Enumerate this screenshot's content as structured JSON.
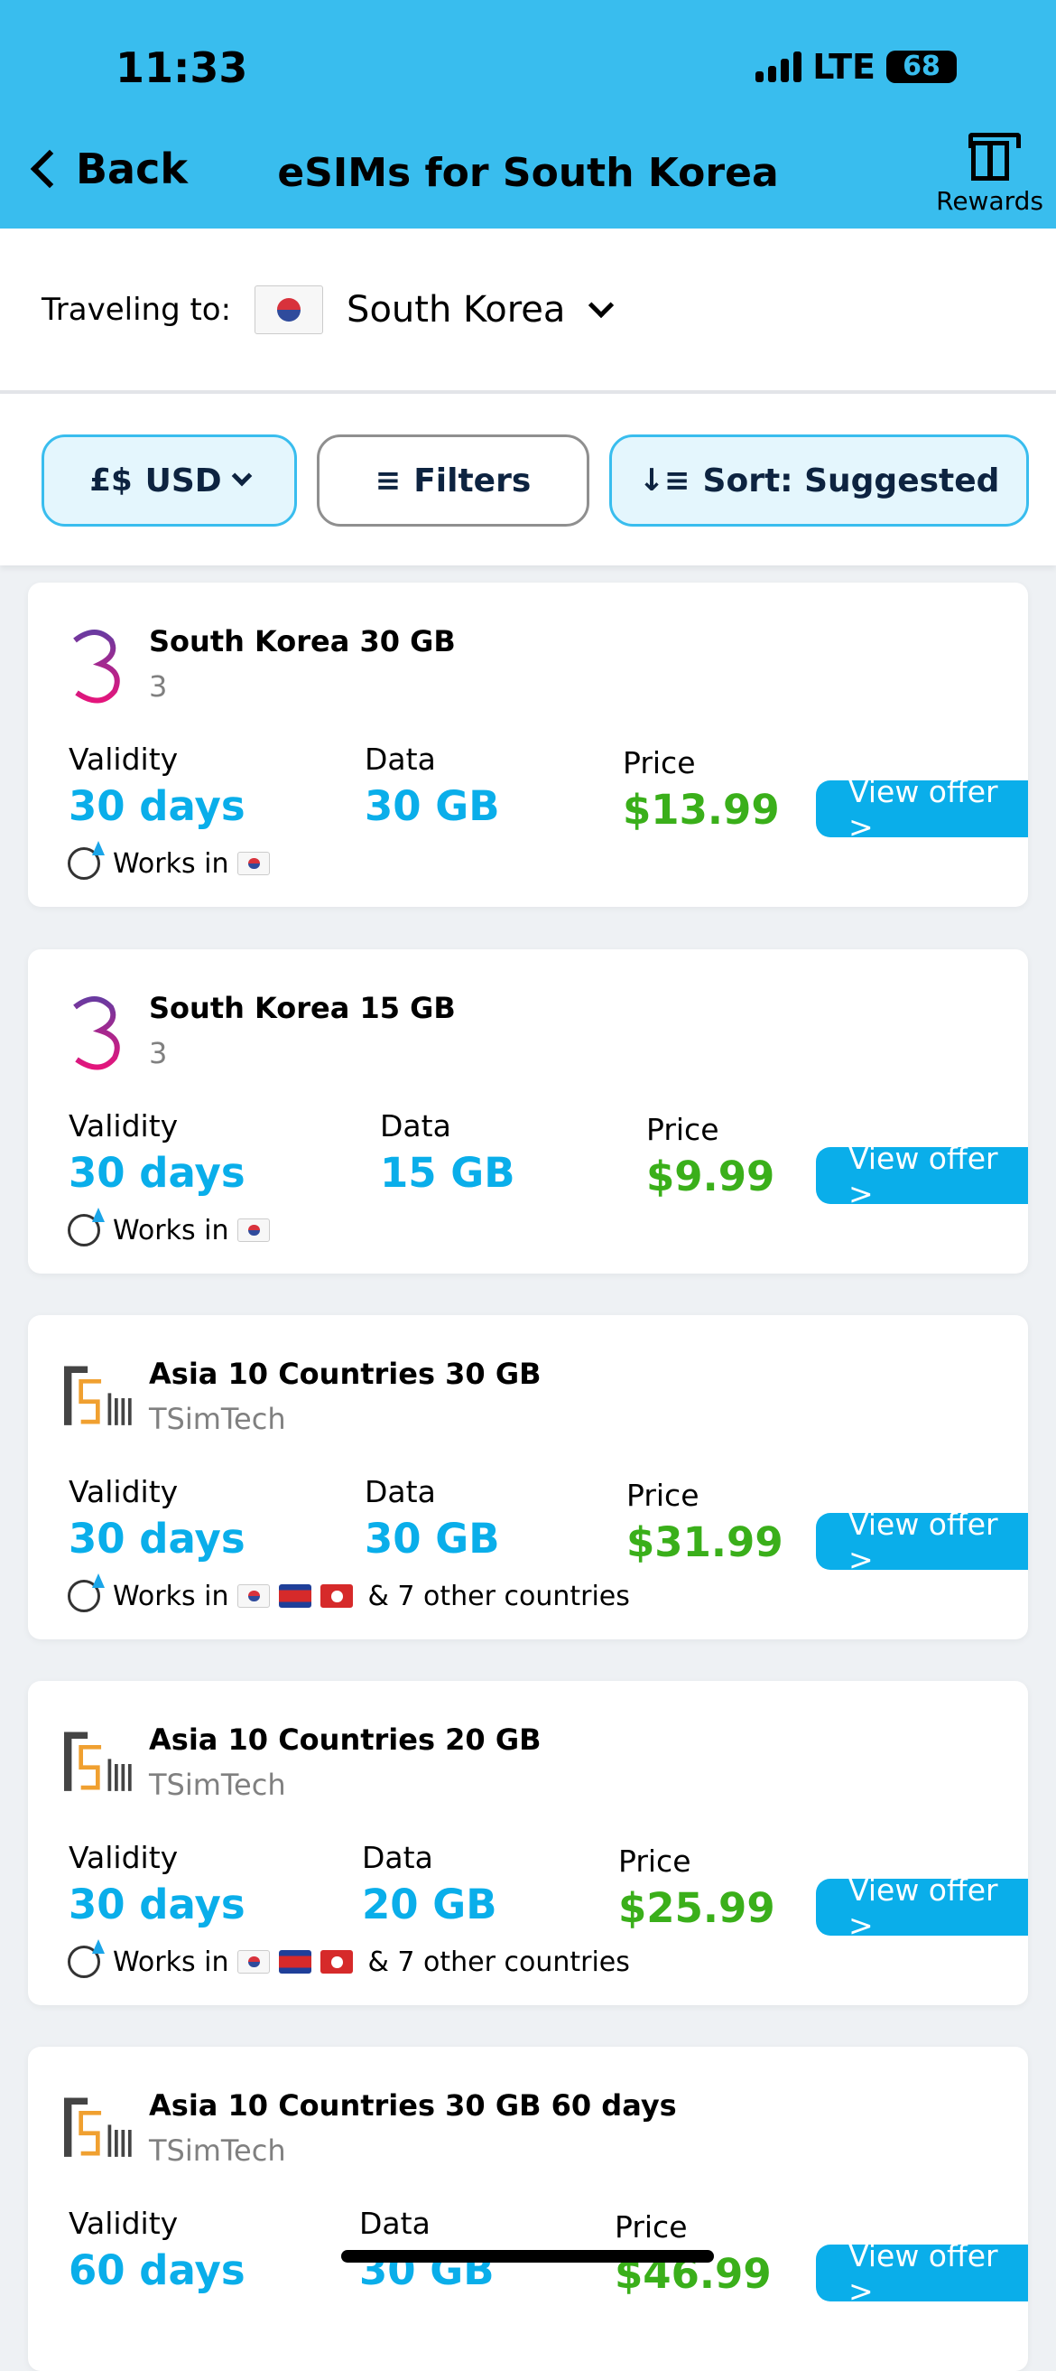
{
  "status_bar": {
    "time": "11:33",
    "network": "LTE",
    "battery": "68"
  },
  "header": {
    "back_label": "Back",
    "title": "eSIMs for South Korea",
    "rewards_label": "Rewards"
  },
  "destination": {
    "label": "Traveling to:",
    "country": "South Korea"
  },
  "toolbar": {
    "currency": "USD",
    "filters": "Filters",
    "sort": "Sort: Suggested"
  },
  "colors": {
    "header": "#39bdee",
    "value": "#0aaeea",
    "price": "#3aaf1a",
    "button": "#0aaeea"
  },
  "labels": {
    "validity": "Validity",
    "data": "Data",
    "price": "Price",
    "view_offer": "View offer >",
    "works_in": "Works in"
  },
  "offers": [
    {
      "title": "South Korea 30 GB",
      "provider": "3",
      "logo": "three-logo",
      "validity": "30 days",
      "data": "30 GB",
      "price": "$13.99",
      "flags": [
        "kr"
      ],
      "extra": ""
    },
    {
      "title": "South Korea 15 GB",
      "provider": "3",
      "logo": "three-logo",
      "validity": "30 days",
      "data": "15 GB",
      "price": "$9.99",
      "flags": [
        "kr"
      ],
      "extra": ""
    },
    {
      "title": "Asia 10 Countries 30 GB",
      "provider": "TSimTech",
      "logo": "tsimtech-logo",
      "validity": "30 days",
      "data": "30 GB",
      "price": "$31.99",
      "flags": [
        "kr",
        "kh",
        "hk"
      ],
      "extra": "& 7 other countries"
    },
    {
      "title": "Asia 10 Countries 20 GB",
      "provider": "TSimTech",
      "logo": "tsimtech-logo",
      "validity": "30 days",
      "data": "20 GB",
      "price": "$25.99",
      "flags": [
        "kr",
        "kh",
        "hk"
      ],
      "extra": "& 7 other countries"
    },
    {
      "title": "Asia 10 Countries 30 GB 60 days",
      "provider": "TSimTech",
      "logo": "tsimtech-logo",
      "validity": "60 days",
      "data": "30 GB",
      "price": "$46.99",
      "flags": [],
      "extra": ""
    }
  ]
}
